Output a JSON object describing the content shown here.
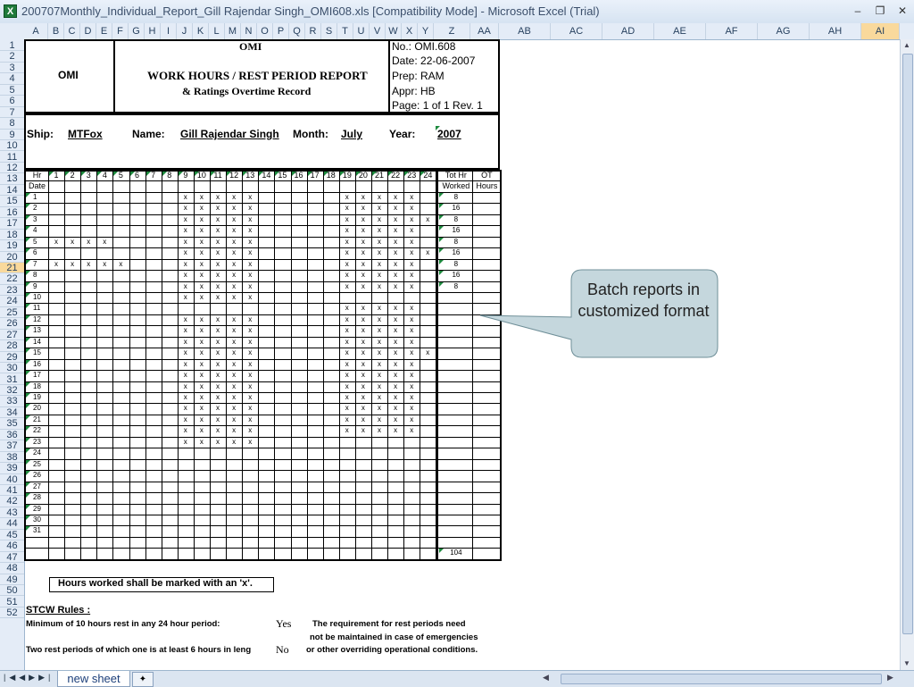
{
  "window": {
    "title": "200707Monthly_Individual_Report_Gill Rajendar Singh_OMI608.xls  [Compatibility Mode] - Microsoft Excel (Trial)",
    "app_icon": "excel-icon",
    "minimize": "–",
    "restore": "❐",
    "close": "✕"
  },
  "columns": [
    "A",
    "B",
    "C",
    "D",
    "E",
    "F",
    "G",
    "H",
    "I",
    "J",
    "K",
    "L",
    "M",
    "N",
    "O",
    "P",
    "Q",
    "R",
    "S",
    "T",
    "U",
    "V",
    "W",
    "X",
    "Y",
    "Z",
    "AA",
    "AB",
    "AC",
    "AD",
    "AE",
    "AF",
    "AG",
    "AH",
    "AI"
  ],
  "rows": [
    "1",
    "2",
    "3",
    "4",
    "5",
    "6",
    "7",
    "8",
    "9",
    "10",
    "11",
    "12",
    "13",
    "14",
    "15",
    "16",
    "17",
    "18",
    "19",
    "20",
    "21",
    "22",
    "23",
    "24",
    "25",
    "26",
    "27",
    "28",
    "29",
    "30",
    "31",
    "32",
    "33",
    "34",
    "35",
    "36",
    "37",
    "38",
    "39",
    "40",
    "41",
    "42",
    "43",
    "44",
    "45",
    "46",
    "47",
    "48",
    "49",
    "50",
    "51",
    "52"
  ],
  "selected_column": "AI",
  "selected_row": "21",
  "report": {
    "company_left": "OMI",
    "company_center": "OMI",
    "title_line1": "WORK HOURS / REST PERIOD REPORT",
    "title_line2": "& Ratings Overtime Record",
    "doc_no": "No.:  OMI.608",
    "date": "Date: 22-06-2007",
    "prep": "Prep: RAM",
    "appr": "Appr: HB",
    "page": "Page: 1 of 1  Rev. 1",
    "ship_label": "Ship:",
    "ship_value": "MTFox",
    "name_label": "Name:",
    "name_value": "Gill Rajendar Singh",
    "month_label": "Month:",
    "month_value": "July",
    "year_label": "Year:",
    "year_value": "2007"
  },
  "grid": {
    "hr_label": "Hr",
    "date_label": "Date",
    "hours": [
      "1",
      "2",
      "3",
      "4",
      "5",
      "6",
      "7",
      "8",
      "9",
      "10",
      "11",
      "12",
      "13",
      "14",
      "15",
      "16",
      "17",
      "18",
      "19",
      "20",
      "21",
      "22",
      "23",
      "24"
    ],
    "tot_hr_label": "Tot Hr",
    "worked_label": "Worked",
    "ot_label": "OT",
    "ot_hours_label": "Hours",
    "mark": "x",
    "dates": [
      {
        "d": "1",
        "h": [
          9,
          10,
          11,
          12,
          13,
          19,
          20,
          21,
          22,
          23
        ],
        "tot": "8"
      },
      {
        "d": "2",
        "h": [
          9,
          10,
          11,
          12,
          13,
          19,
          20,
          21,
          22,
          23
        ],
        "tot": "16"
      },
      {
        "d": "3",
        "h": [
          9,
          10,
          11,
          12,
          13,
          19,
          20,
          21,
          22,
          23,
          24
        ],
        "tot": "8"
      },
      {
        "d": "4",
        "h": [
          9,
          10,
          11,
          12,
          13,
          19,
          20,
          21,
          22,
          23
        ],
        "tot": "16"
      },
      {
        "d": "5",
        "h": [
          1,
          2,
          3,
          4,
          9,
          10,
          11,
          12,
          13,
          19,
          20,
          21,
          22,
          23
        ],
        "tot": "8"
      },
      {
        "d": "6",
        "h": [
          9,
          10,
          11,
          12,
          13,
          19,
          20,
          21,
          22,
          23,
          24
        ],
        "tot": "16"
      },
      {
        "d": "7",
        "h": [
          1,
          2,
          3,
          4,
          5,
          9,
          10,
          11,
          12,
          13,
          19,
          20,
          21,
          22,
          23
        ],
        "tot": "8"
      },
      {
        "d": "8",
        "h": [
          9,
          10,
          11,
          12,
          13,
          19,
          20,
          21,
          22,
          23
        ],
        "tot": "16"
      },
      {
        "d": "9",
        "h": [
          9,
          10,
          11,
          12,
          13,
          19,
          20,
          21,
          22,
          23
        ],
        "tot": "8"
      },
      {
        "d": "10",
        "h": [
          9,
          10,
          11,
          12,
          13
        ],
        "tot": ""
      },
      {
        "d": "11",
        "h": [
          19,
          20,
          21,
          22,
          23
        ],
        "tot": ""
      },
      {
        "d": "12",
        "h": [
          9,
          10,
          11,
          12,
          13,
          19,
          20,
          21,
          22,
          23
        ],
        "tot": ""
      },
      {
        "d": "13",
        "h": [
          9,
          10,
          11,
          12,
          13,
          19,
          20,
          21,
          22,
          23
        ],
        "tot": ""
      },
      {
        "d": "14",
        "h": [
          9,
          10,
          11,
          12,
          13,
          19,
          20,
          21,
          22,
          23
        ],
        "tot": ""
      },
      {
        "d": "15",
        "h": [
          9,
          10,
          11,
          12,
          13,
          19,
          20,
          21,
          22,
          23,
          24
        ],
        "tot": ""
      },
      {
        "d": "16",
        "h": [
          9,
          10,
          11,
          12,
          13,
          19,
          20,
          21,
          22,
          23
        ],
        "tot": ""
      },
      {
        "d": "17",
        "h": [
          9,
          10,
          11,
          12,
          13,
          19,
          20,
          21,
          22,
          23
        ],
        "tot": ""
      },
      {
        "d": "18",
        "h": [
          9,
          10,
          11,
          12,
          13,
          19,
          20,
          21,
          22,
          23
        ],
        "tot": ""
      },
      {
        "d": "19",
        "h": [
          9,
          10,
          11,
          12,
          13,
          19,
          20,
          21,
          22,
          23
        ],
        "tot": ""
      },
      {
        "d": "20",
        "h": [
          9,
          10,
          11,
          12,
          13,
          19,
          20,
          21,
          22,
          23
        ],
        "tot": ""
      },
      {
        "d": "21",
        "h": [
          9,
          10,
          11,
          12,
          13,
          19,
          20,
          21,
          22,
          23
        ],
        "tot": ""
      },
      {
        "d": "22",
        "h": [
          9,
          10,
          11,
          12,
          13,
          19,
          20,
          21,
          22,
          23
        ],
        "tot": ""
      },
      {
        "d": "23",
        "h": [
          9,
          10,
          11,
          12,
          13
        ],
        "tot": ""
      },
      {
        "d": "24",
        "h": [],
        "tot": ""
      },
      {
        "d": "25",
        "h": [],
        "tot": ""
      },
      {
        "d": "26",
        "h": [],
        "tot": ""
      },
      {
        "d": "27",
        "h": [],
        "tot": ""
      },
      {
        "d": "28",
        "h": [],
        "tot": ""
      },
      {
        "d": "29",
        "h": [],
        "tot": ""
      },
      {
        "d": "30",
        "h": [],
        "tot": ""
      },
      {
        "d": "31",
        "h": [],
        "tot": ""
      }
    ],
    "total": "104"
  },
  "notes": {
    "instruction": "Hours worked shall be marked with an 'x'.",
    "stcw_title": "STCW Rules :",
    "rule1": "Minimum of 10 hours rest in any 24 hour period:",
    "rule1_answer": "Yes",
    "rule2": "Two rest periods of which one is at least 6 hours in leng",
    "rule2_answer": "No",
    "req1": "The requirement for rest periods need",
    "req2": "not be maintained in case of emergencies",
    "req3": "or other overriding operational conditions."
  },
  "callout": {
    "text": "Batch reports in customized format",
    "fill": "#c5d7dd"
  },
  "sheet_tab": "new sheet",
  "colors": {
    "selected_header": "#f9d99c",
    "tri_marker": "#1d8a3e"
  }
}
